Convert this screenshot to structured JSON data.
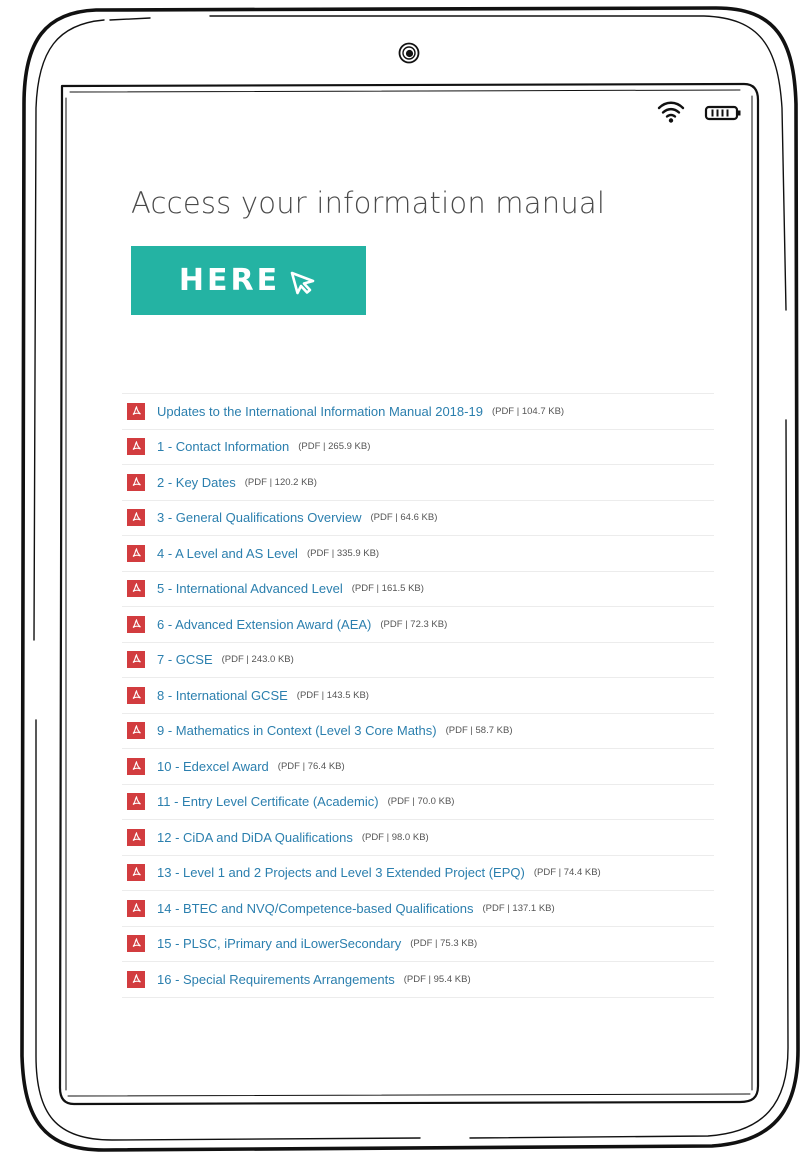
{
  "heading": "Access your information manual",
  "here_button": {
    "label": "HERE",
    "color": "#24b3a3"
  },
  "brand_colors": {
    "pdf_icon": "#d23c3f",
    "link": "#2b7fae"
  },
  "icons": [
    "camera-icon",
    "wifi-icon",
    "battery-icon",
    "cursor-arrow-icon",
    "pdf-file-icon"
  ],
  "manual_items": [
    {
      "title": "Updates to the International Information Manual 2018-19",
      "meta": "(PDF | 104.7 KB)"
    },
    {
      "title": "1 - Contact Information",
      "meta": "(PDF | 265.9 KB)"
    },
    {
      "title": "2 - Key Dates",
      "meta": "(PDF | 120.2 KB)"
    },
    {
      "title": "3 - General Qualifications Overview",
      "meta": "(PDF | 64.6 KB)"
    },
    {
      "title": "4 - A Level and AS Level",
      "meta": "(PDF | 335.9 KB)"
    },
    {
      "title": "5 - International Advanced Level",
      "meta": "(PDF | 161.5 KB)"
    },
    {
      "title": "6 - Advanced Extension Award (AEA)",
      "meta": "(PDF | 72.3 KB)"
    },
    {
      "title": "7 - GCSE",
      "meta": "(PDF | 243.0 KB)"
    },
    {
      "title": "8 - International GCSE",
      "meta": "(PDF | 143.5 KB)"
    },
    {
      "title": "9 - Mathematics in Context (Level 3 Core Maths)",
      "meta": "(PDF | 58.7 KB)"
    },
    {
      "title": "10 - Edexcel Award",
      "meta": "(PDF | 76.4 KB)"
    },
    {
      "title": "11 - Entry Level Certificate (Academic)",
      "meta": "(PDF | 70.0 KB)"
    },
    {
      "title": "12 - CiDA and DiDA Qualifications",
      "meta": "(PDF | 98.0 KB)"
    },
    {
      "title": "13 - Level 1 and 2 Projects and Level 3 Extended Project (EPQ)",
      "meta": "(PDF | 74.4 KB)"
    },
    {
      "title": "14 - BTEC and NVQ/Competence-based Qualifications",
      "meta": "(PDF | 137.1 KB)"
    },
    {
      "title": "15 - PLSC, iPrimary and iLowerSecondary",
      "meta": "(PDF | 75.3 KB)"
    },
    {
      "title": "16 - Special Requirements Arrangements",
      "meta": "(PDF | 95.4 KB)"
    }
  ]
}
